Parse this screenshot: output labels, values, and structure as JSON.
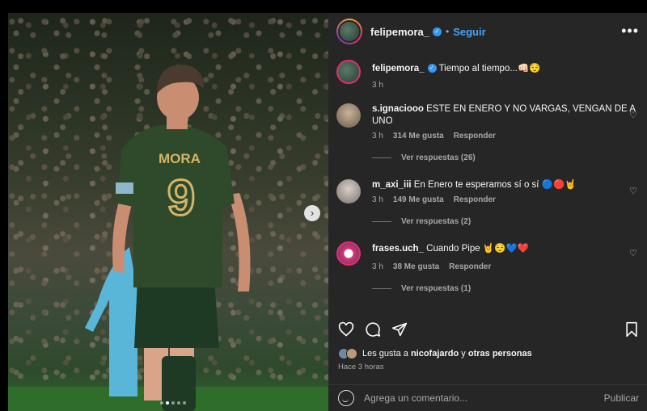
{
  "post": {
    "username": "felipemora_",
    "follow_label": "Seguir",
    "separator": "•",
    "more_label": "•••",
    "caption_text": "Tiempo al tiempo...",
    "caption_emoji": "👊🏻😌",
    "caption_time": "3 h",
    "jersey_name": "MORA",
    "jersey_number": "9",
    "slide_count": 5,
    "active_slide": 2
  },
  "comments": [
    {
      "user": "s.ignaciooo",
      "text": "ESTE EN ENERO Y NO VARGAS, VENGAN DE A UNO",
      "time": "3 h",
      "likes": "314 Me gusta",
      "reply": "Responder",
      "replies_label": "Ver respuestas (26)"
    },
    {
      "user": "m_axi_iii",
      "text": "En Enero te esperamos sí o sí 🔵🔴🤘",
      "time": "3 h",
      "likes": "149 Me gusta",
      "reply": "Responder",
      "replies_label": "Ver respuestas (2)"
    },
    {
      "user": "frases.uch_",
      "text": "Cuando Pipe 🤘😌💙❤️",
      "time": "3 h",
      "likes": "38 Me gusta",
      "reply": "Responder",
      "replies_label": "Ver respuestas (1)"
    }
  ],
  "likes_line": {
    "prefix": "Les gusta a ",
    "user": "nicofajardo",
    "middle": " y ",
    "others": "otras personas"
  },
  "posted_ago": "Hace 3 horas",
  "composer": {
    "placeholder": "Agrega un comentario...",
    "publish_label": "Publicar"
  },
  "icons": {
    "heart": "heart-icon",
    "comment": "comment-icon",
    "share": "share-icon",
    "save": "bookmark-icon",
    "emoji": "emoji-icon",
    "more": "more-icon",
    "verified": "verified-badge-icon",
    "next": "chevron-right-icon"
  },
  "colors": {
    "panel_bg": "#262626",
    "accent_blue": "#4aa3f7",
    "verified": "#3897f0",
    "muted": "#a8a8a8",
    "jersey": "#2e4a2a",
    "jersey_number": "#d4b46a"
  }
}
